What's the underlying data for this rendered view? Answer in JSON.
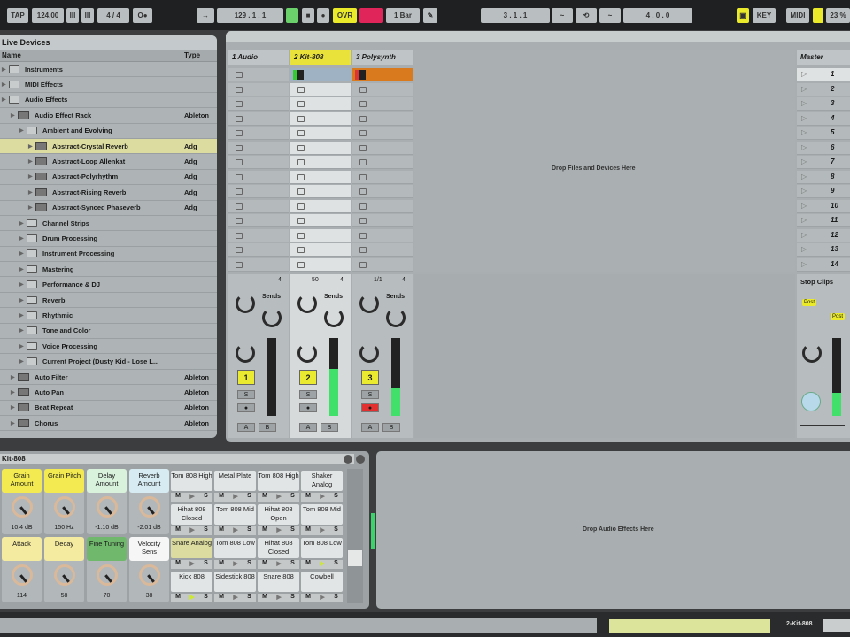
{
  "transport": {
    "tap": "TAP",
    "tempo": "124.00",
    "nudge_down": "III",
    "nudge_up": "III",
    "signature": "4 / 4",
    "metronome": "O●",
    "follow": "→",
    "arrangement_position": "129 . 1 . 1",
    "overdub": "OVR",
    "quantize": "1 Bar",
    "loop_start": "3 . 1 . 1",
    "loop_length": "4 . 0 . 0",
    "key": "KEY",
    "midi": "MIDI",
    "cpu": "23 %"
  },
  "browser": {
    "title": "Live Devices",
    "col_name": "Name",
    "col_type": "Type",
    "items": [
      {
        "label": "Instruments",
        "type": "",
        "indent": 0,
        "icon": "folder"
      },
      {
        "label": "MIDI Effects",
        "type": "",
        "indent": 0,
        "icon": "folder"
      },
      {
        "label": "Audio Effects",
        "type": "",
        "indent": 0,
        "icon": "folder"
      },
      {
        "label": "Audio Effect Rack",
        "type": "Ableton",
        "indent": 1,
        "icon": "device"
      },
      {
        "label": "Ambient and Evolving",
        "type": "",
        "indent": 2,
        "icon": "folder"
      },
      {
        "label": "Abstract-Crystal Reverb",
        "type": "Adg",
        "indent": 3,
        "icon": "device",
        "selected": true
      },
      {
        "label": "Abstract-Loop Allenkat",
        "type": "Adg",
        "indent": 3,
        "icon": "device"
      },
      {
        "label": "Abstract-Polyrhythm",
        "type": "Adg",
        "indent": 3,
        "icon": "device"
      },
      {
        "label": "Abstract-Rising Reverb",
        "type": "Adg",
        "indent": 3,
        "icon": "device"
      },
      {
        "label": "Abstract-Synced Phaseverb",
        "type": "Adg",
        "indent": 3,
        "icon": "device"
      },
      {
        "label": "Channel Strips",
        "type": "",
        "indent": 2,
        "icon": "folder"
      },
      {
        "label": "Drum Processing",
        "type": "",
        "indent": 2,
        "icon": "folder"
      },
      {
        "label": "Instrument Processing",
        "type": "",
        "indent": 2,
        "icon": "folder"
      },
      {
        "label": "Mastering",
        "type": "",
        "indent": 2,
        "icon": "folder"
      },
      {
        "label": "Performance & DJ",
        "type": "",
        "indent": 2,
        "icon": "folder"
      },
      {
        "label": "Reverb",
        "type": "",
        "indent": 2,
        "icon": "folder"
      },
      {
        "label": "Rhythmic",
        "type": "",
        "indent": 2,
        "icon": "folder"
      },
      {
        "label": "Tone and Color",
        "type": "",
        "indent": 2,
        "icon": "folder"
      },
      {
        "label": "Voice Processing",
        "type": "",
        "indent": 2,
        "icon": "folder"
      },
      {
        "label": "Current Project (Dusty Kid - Lose L...",
        "type": "",
        "indent": 2,
        "icon": "folder"
      },
      {
        "label": "Auto Filter",
        "type": "Ableton",
        "indent": 1,
        "icon": "device"
      },
      {
        "label": "Auto Pan",
        "type": "Ableton",
        "indent": 1,
        "icon": "device"
      },
      {
        "label": "Beat Repeat",
        "type": "Ableton",
        "indent": 1,
        "icon": "device"
      },
      {
        "label": "Chorus",
        "type": "Ableton",
        "indent": 1,
        "icon": "device"
      }
    ]
  },
  "session": {
    "tracks": [
      {
        "name": "1 Audio",
        "number": "1",
        "header_color": "#bfc4c6",
        "meter": 0,
        "info": "",
        "arm": false
      },
      {
        "name": "2 Kit-808",
        "number": "2",
        "header_color": "#e8e23a",
        "meter": 0.6,
        "info": "50",
        "arm": false
      },
      {
        "name": "3 Polysynth",
        "number": "3",
        "header_color": "#bfc4c6",
        "meter": 0.35,
        "info": "1/1",
        "arm": true
      }
    ],
    "master": {
      "name": "Master",
      "scenes": [
        "1",
        "2",
        "3",
        "4",
        "5",
        "6",
        "7",
        "8",
        "9",
        "10",
        "11",
        "12",
        "13",
        "14"
      ],
      "stop_clips": "Stop Clips",
      "meter": 0.3
    },
    "drop_text": "Drop Files and Devices Here",
    "sends_label": "Sends",
    "send_a": "A",
    "send_b": "B",
    "solo": "S",
    "monitor_in": "4",
    "post_label": "Post"
  },
  "device": {
    "title": "Kit-808",
    "macros": [
      {
        "label": "Grain Amount",
        "value": "10.4 dB",
        "color": "#f2ea50"
      },
      {
        "label": "Grain Pitch",
        "value": "150 Hz",
        "color": "#f2ea50"
      },
      {
        "label": "Delay Amount",
        "value": "-1.10 dB",
        "color": "#d9f2dc"
      },
      {
        "label": "Reverb Amount",
        "value": "-2.01 dB",
        "color": "#d6ecf2"
      },
      {
        "label": "Attack",
        "value": "114",
        "color": "#f4eaa0"
      },
      {
        "label": "Decay",
        "value": "58",
        "color": "#f4eaa0"
      },
      {
        "label": "Fine Tuning",
        "value": "70",
        "color": "#6fb86c"
      },
      {
        "label": "Velocity Sens",
        "value": "38",
        "color": "#f6f6f6"
      }
    ],
    "pads": [
      [
        "Tom 808 High",
        "Metal Plate",
        "Tom 808 High",
        "Shaker Analog"
      ],
      [
        "Hihat 808 Closed",
        "Tom 808 Mid",
        "Hihat 808 Open",
        "Tom 808 Mid"
      ],
      [
        "Snare Analog",
        "Tom 808 Low",
        "Hihat 808 Closed",
        "Tom 808 Low"
      ],
      [
        "Kick 808",
        "Sidestick 808",
        "Snare 808",
        "Cowbell"
      ]
    ],
    "pad_mute": "M",
    "pad_play": "▶",
    "pad_solo": "S",
    "drop_fx": "Drop Audio Effects Here"
  },
  "status": {
    "track_name": "2-Kit-808"
  }
}
